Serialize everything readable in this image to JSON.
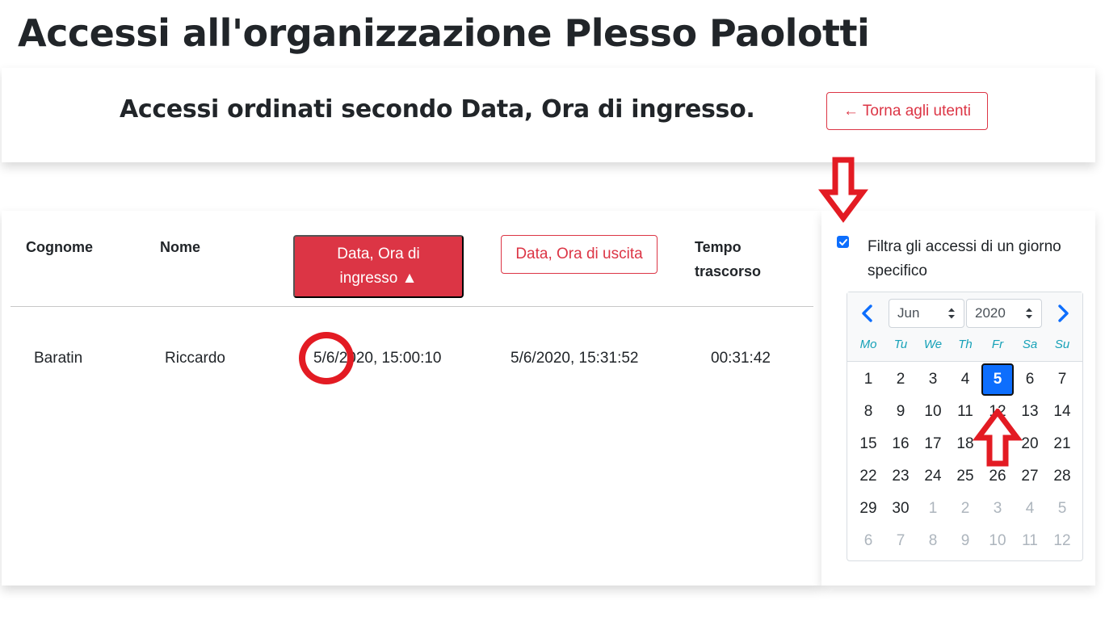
{
  "page": {
    "title": "Accessi all'organizzazione Plesso Paolotti"
  },
  "header": {
    "subtitle": "Accessi ordinati secondo Data, Ora di ingresso.",
    "back_button": "← Torna agli utenti"
  },
  "table": {
    "columns": {
      "surname": "Cognome",
      "name": "Nome",
      "entry": "Data, Ora di ingresso ▲",
      "exit": "Data, Ora di uscita",
      "elapsed": "Tempo trascorso"
    },
    "rows": [
      {
        "surname": "Baratin",
        "name": "Riccardo",
        "entry": "5/6/2020, 15:00:10",
        "exit": "5/6/2020, 15:31:52",
        "elapsed": "00:31:42"
      }
    ]
  },
  "filter": {
    "checked": true,
    "label": "Filtra gli accessi di un giorno specifico"
  },
  "calendar": {
    "month": "Jun",
    "year": "2020",
    "weekdays": [
      "Mo",
      "Tu",
      "We",
      "Th",
      "Fr",
      "Sa",
      "Su"
    ],
    "weeks": [
      [
        "1",
        "2",
        "3",
        "4",
        "5",
        "6",
        "7"
      ],
      [
        "8",
        "9",
        "10",
        "11",
        "12",
        "13",
        "14"
      ],
      [
        "15",
        "16",
        "17",
        "18",
        "19",
        "20",
        "21"
      ],
      [
        "22",
        "23",
        "24",
        "25",
        "26",
        "27",
        "28"
      ],
      [
        "29",
        "30",
        "1",
        "2",
        "3",
        "4",
        "5"
      ],
      [
        "6",
        "7",
        "8",
        "9",
        "10",
        "11",
        "12"
      ]
    ],
    "muted_from": [
      4,
      2
    ],
    "selected": [
      0,
      4
    ],
    "accent_color": "#0d6efd",
    "weekday_color": "#17a2b8"
  },
  "annotations": {
    "color": "#e31b23",
    "marks": [
      "arrow-down-icon",
      "arrow-up-icon",
      "highlight-circle"
    ]
  }
}
